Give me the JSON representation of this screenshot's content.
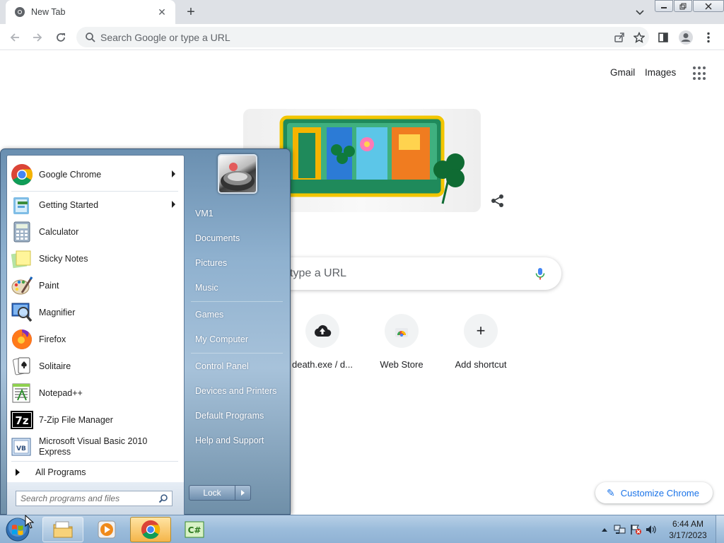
{
  "browser": {
    "tab_title": "New Tab",
    "omnibox_placeholder": "Search Google or type a URL"
  },
  "ntp": {
    "gmail": "Gmail",
    "images": "Images",
    "search_placeholder_visible": "type a URL",
    "shortcuts": [
      {
        "label": "death.exe / d...",
        "icon": "upload-cloud-icon"
      },
      {
        "label": "Web Store",
        "icon": "chrome-web-store-icon"
      },
      {
        "label": "Add shortcut",
        "icon": "plus-icon"
      }
    ],
    "customize_label": "Customize Chrome"
  },
  "start_menu": {
    "programs": [
      {
        "label": "Google Chrome",
        "icon": "chrome-icon",
        "submenu": true
      },
      {
        "label": "Getting Started",
        "icon": "getting-started-icon",
        "submenu": true
      },
      {
        "label": "Calculator",
        "icon": "calculator-icon",
        "submenu": false
      },
      {
        "label": "Sticky Notes",
        "icon": "sticky-notes-icon",
        "submenu": false
      },
      {
        "label": "Paint",
        "icon": "paint-icon",
        "submenu": false
      },
      {
        "label": "Magnifier",
        "icon": "magnifier-icon",
        "submenu": false
      },
      {
        "label": "Firefox",
        "icon": "firefox-icon",
        "submenu": false
      },
      {
        "label": "Solitaire",
        "icon": "solitaire-icon",
        "submenu": false
      },
      {
        "label": "Notepad++",
        "icon": "notepad-plus-icon",
        "submenu": false
      },
      {
        "label": "7-Zip File Manager",
        "icon": "7zip-icon",
        "submenu": false
      },
      {
        "label": "Microsoft Visual Basic 2010 Express",
        "icon": "visual-basic-icon",
        "submenu": false
      }
    ],
    "all_programs": "All Programs",
    "search_placeholder": "Search programs and files",
    "places": [
      {
        "label": "VM1"
      },
      {
        "label": "Documents"
      },
      {
        "label": "Pictures"
      },
      {
        "label": "Music"
      },
      {
        "label": "Games"
      },
      {
        "label": "My Computer"
      },
      {
        "label": "Control Panel"
      },
      {
        "label": "Devices and Printers"
      },
      {
        "label": "Default Programs"
      },
      {
        "label": "Help and Support"
      }
    ],
    "lock_label": "Lock"
  },
  "taskbar": {
    "time": "6:44 AM",
    "date": "3/17/2023"
  },
  "colors": {
    "chrome_blue": "#1a73e8",
    "taskbar": "#9bbcdb",
    "active_task": "#f4b54a"
  }
}
